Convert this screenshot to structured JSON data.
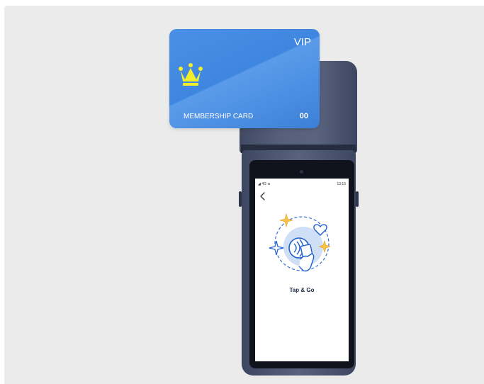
{
  "card": {
    "badge": "VIP",
    "label": "MEMBERSHIP CARD",
    "number": "00",
    "icon": "crown-icon",
    "color": "#4289e3",
    "crown_color": "#f2ee2e"
  },
  "device": {
    "status_bar": {
      "left": "4G",
      "time": "13:15"
    },
    "screen": {
      "back_icon": "chevron-left-icon",
      "illustration_icon": "nfc-tap-hand-icon",
      "title": "Tap & Go"
    },
    "body_color": "#4b546d"
  }
}
